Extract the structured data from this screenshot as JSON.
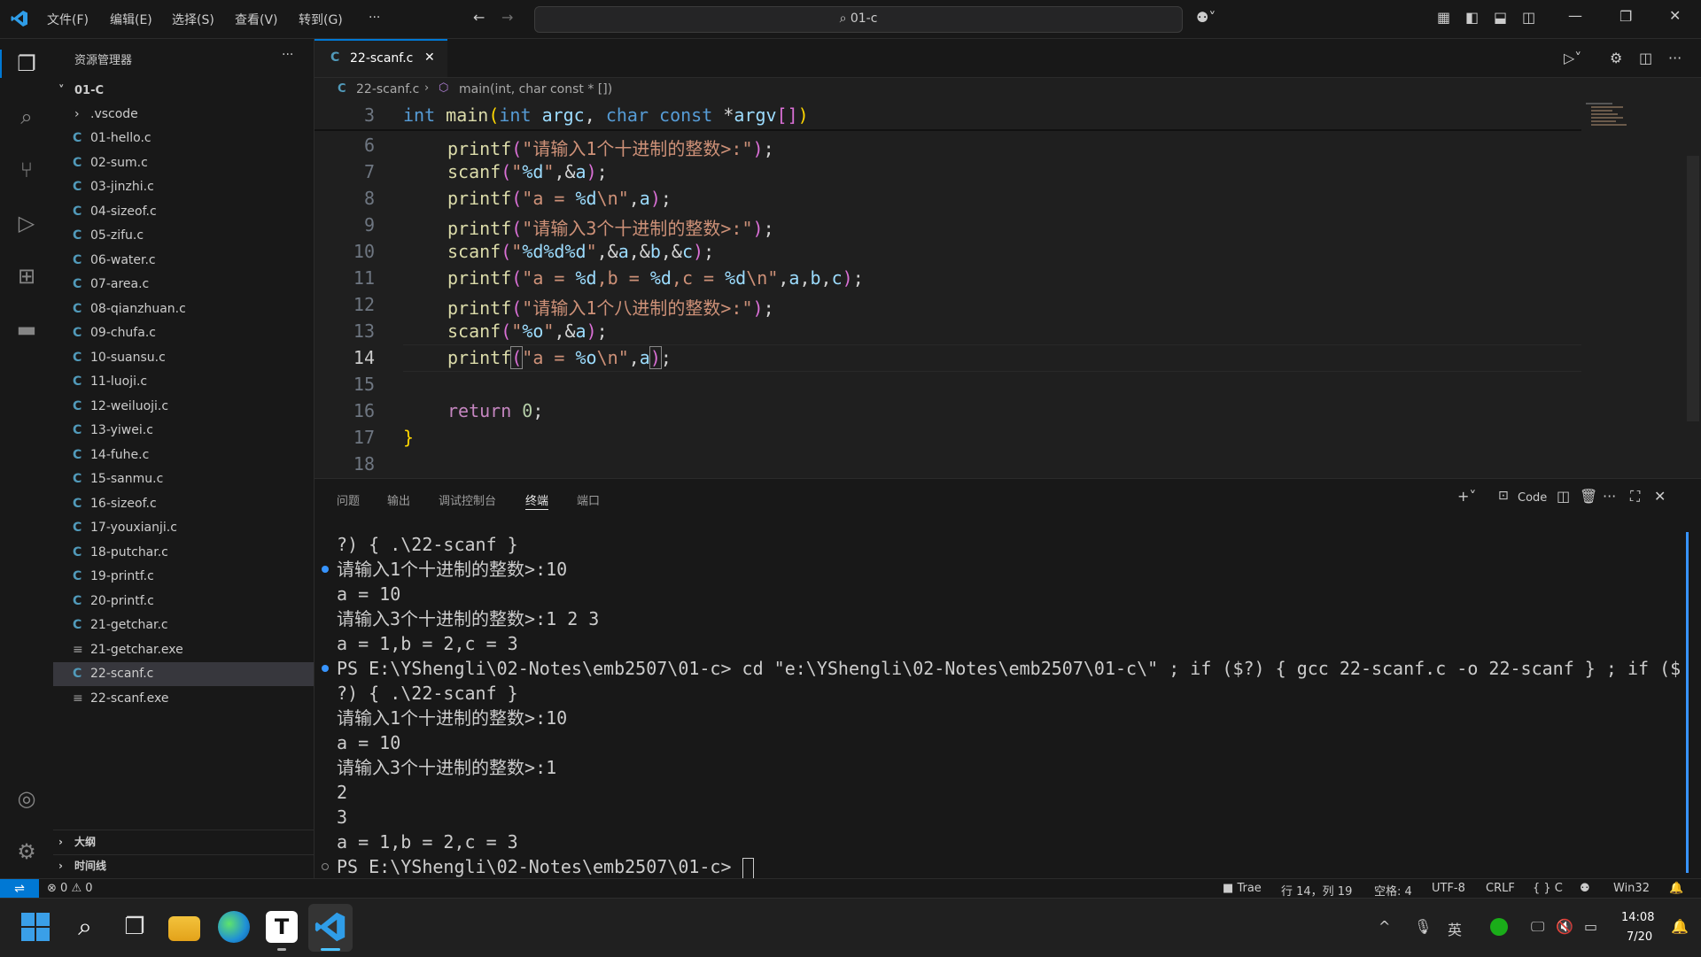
{
  "titlebar": {
    "menus": [
      "文件(F)",
      "编辑(E)",
      "选择(S)",
      "查看(V)",
      "转到(G)",
      "···"
    ],
    "search_text": "01-c"
  },
  "sidebar": {
    "title": "资源管理器",
    "more": "···",
    "root": "01-C",
    "folder": ".vscode",
    "files": [
      "01-hello.c",
      "02-sum.c",
      "03-jinzhi.c",
      "04-sizeof.c",
      "05-zifu.c",
      "06-water.c",
      "07-area.c",
      "08-qianzhuan.c",
      "09-chufa.c",
      "10-suansu.c",
      "11-luoji.c",
      "12-weiluoji.c",
      "13-yiwei.c",
      "14-fuhe.c",
      "15-sanmu.c",
      "16-sizeof.c",
      "17-youxianji.c",
      "18-putchar.c",
      "19-printf.c",
      "20-printf.c",
      "21-getchar.c",
      "21-getchar.exe",
      "22-scanf.c",
      "22-scanf.exe"
    ],
    "file_icon": "C",
    "exe_icon": "≡",
    "outline": "大纲",
    "timeline": "时间线"
  },
  "editor": {
    "tab_icon": "C",
    "tab_label": "22-scanf.c",
    "breadcrumb_file": "22-scanf.c",
    "breadcrumb_symbol": "main(int, char const * [])",
    "line_numbers": [
      "3",
      "6",
      "7",
      "8",
      "9",
      "10",
      "11",
      "12",
      "13",
      "14",
      "15",
      "16",
      "17",
      "18"
    ]
  },
  "panel": {
    "tabs": [
      "问题",
      "输出",
      "调试控制台",
      "终端",
      "端口"
    ],
    "shell_label": "Code",
    "terminal_lines": [
      "?) { .\\22-scanf }",
      "请输入1个十进制的整数>:10",
      "a = 10",
      "请输入3个十进制的整数>:1 2 3",
      "a = 1,b = 2,c = 3",
      "PS E:\\YShengli\\02-Notes\\emb2507\\01-c> cd \"e:\\YShengli\\02-Notes\\emb2507\\01-c\\\" ; if ($?) { gcc 22-scanf.c -o 22-scanf } ; if ($",
      "?) { .\\22-scanf }",
      "请输入1个十进制的整数>:10",
      "a = 10",
      "请输入3个十进制的整数>:1",
      "2",
      "3",
      "a = 1,b = 2,c = 3",
      "PS E:\\YShengli\\02-Notes\\emb2507\\01-c> "
    ]
  },
  "statusbar": {
    "errors": "0",
    "warnings": "0",
    "trae": "Trae",
    "position": "行 14，列 19",
    "spaces": "空格: 4",
    "encoding": "UTF-8",
    "eol": "CRLF",
    "language": "{ } C",
    "platform": "Win32"
  },
  "taskbar": {
    "ime": "英",
    "time": "14:08",
    "date": "7/20"
  },
  "colors": {
    "accent": "#0078d4",
    "keyword": "#569cd6",
    "string": "#ce9178",
    "function": "#dcdcaa",
    "variable": "#9cdcfe"
  }
}
